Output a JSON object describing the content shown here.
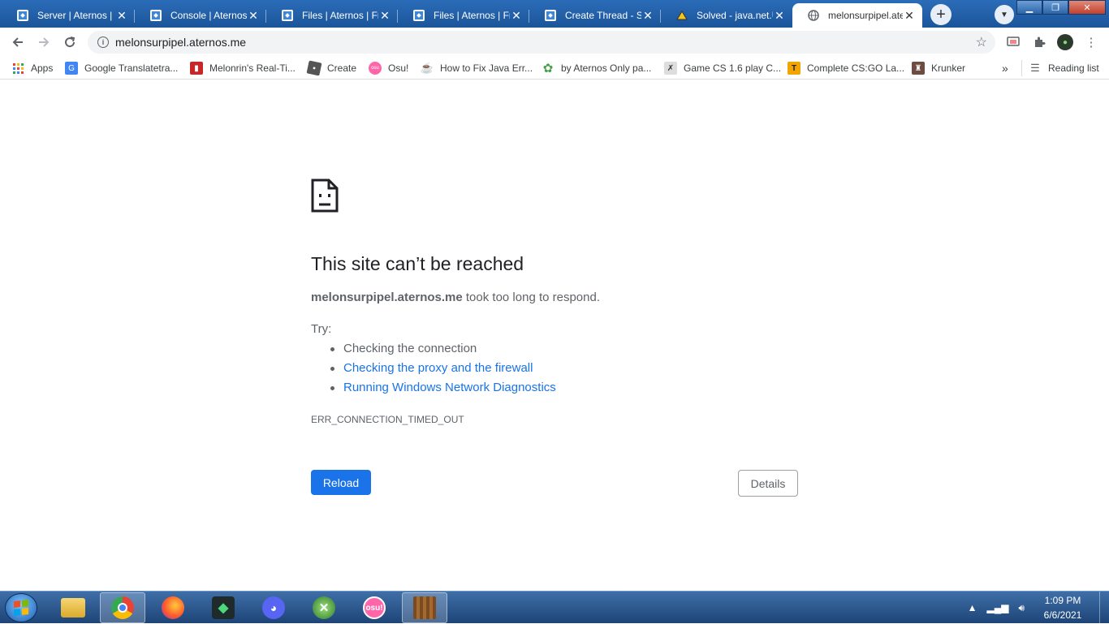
{
  "tabs": [
    {
      "title": "Server | Aternos | F",
      "icon": "aternos-icon"
    },
    {
      "title": "Console | Aternos",
      "icon": "aternos-icon"
    },
    {
      "title": "Files | Aternos | Fre",
      "icon": "aternos-icon"
    },
    {
      "title": "Files | Aternos | Fre",
      "icon": "aternos-icon"
    },
    {
      "title": "Create Thread - Se",
      "icon": "aternos-icon"
    },
    {
      "title": "Solved - java.net.U",
      "icon": "spigot-icon"
    },
    {
      "title": "melonsurpipel.ate",
      "icon": "globe-icon",
      "active": true
    }
  ],
  "toolbar": {
    "url": "melonsurpipel.aternos.me"
  },
  "bookmarks": {
    "items": [
      {
        "label": "Apps",
        "icon": "apps-grid-icon"
      },
      {
        "label": "Google Translatetra...",
        "icon": "google-translate-icon"
      },
      {
        "label": "Melonrin's Real-Ti...",
        "icon": "chart-icon"
      },
      {
        "label": "Create",
        "icon": "roblox-icon"
      },
      {
        "label": "Osu!",
        "icon": "osu-icon"
      },
      {
        "label": "How to Fix Java Err...",
        "icon": "java-icon"
      },
      {
        "label": "by Aternos Only pa...",
        "icon": "gear-green-icon"
      },
      {
        "label": "Game CS 1.6 play C...",
        "icon": "cs-icon"
      },
      {
        "label": "Complete CS:GO La...",
        "icon": "t-icon"
      },
      {
        "label": "Krunker",
        "icon": "krunker-icon"
      }
    ],
    "overflow": "»",
    "reading_list": "Reading list"
  },
  "error": {
    "title": "This site can’t be reached",
    "host": "melonsurpipel.aternos.me",
    "message": " took too long to respond.",
    "try_label": "Try:",
    "suggestions": [
      {
        "text": "Checking the connection",
        "link": false
      },
      {
        "text": "Checking the proxy and the firewall",
        "link": true
      },
      {
        "text": "Running Windows Network Diagnostics",
        "link": true
      }
    ],
    "code": "ERR_CONNECTION_TIMED_OUT",
    "reload_label": "Reload",
    "details_label": "Details"
  },
  "taskbar": {
    "time": "1:09 PM",
    "date": "6/6/2021",
    "osu_label": "osu!"
  },
  "colors": {
    "link": "#1a73e8",
    "tabstrip": "#1e5fa8",
    "button": "#1a73e8"
  }
}
